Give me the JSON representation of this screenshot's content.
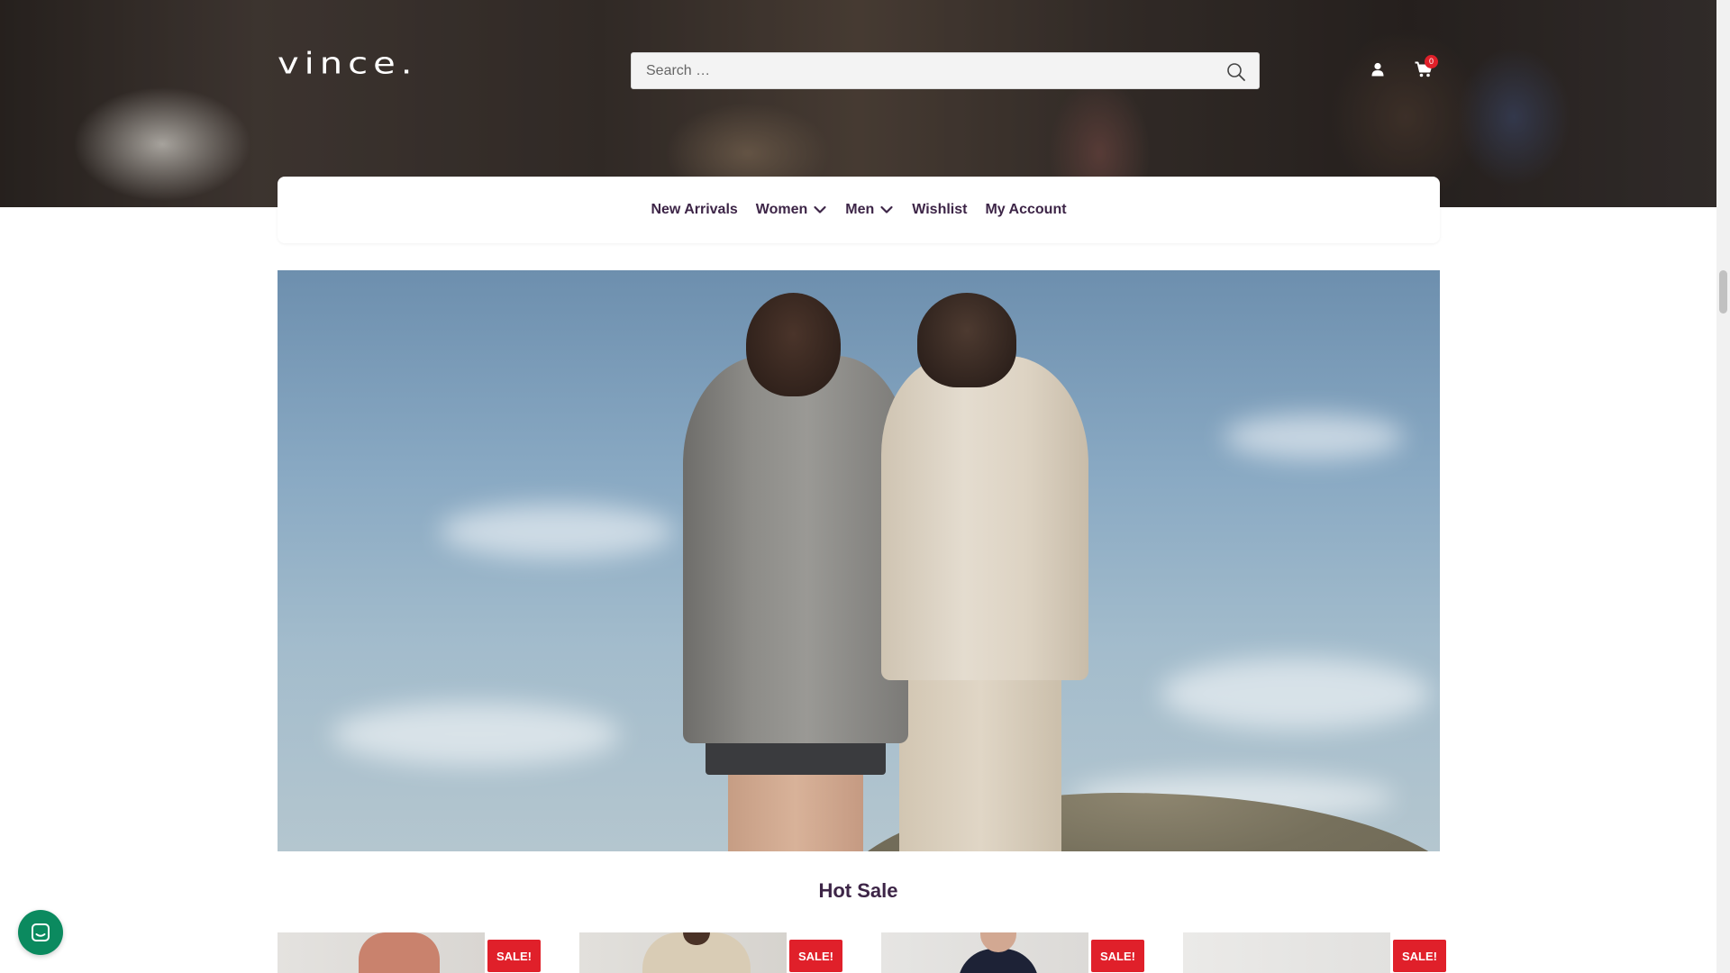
{
  "brand": {
    "logo_text": "vince."
  },
  "search": {
    "placeholder": "Search …"
  },
  "header": {
    "cart_count": "0"
  },
  "nav": {
    "items": [
      {
        "label": "New Arrivals",
        "has_dropdown": false
      },
      {
        "label": "Women",
        "has_dropdown": true
      },
      {
        "label": "Men",
        "has_dropdown": true
      },
      {
        "label": "Wishlist",
        "has_dropdown": false
      },
      {
        "label": "My Account",
        "has_dropdown": false
      }
    ]
  },
  "section": {
    "title": "Hot Sale"
  },
  "products": [
    {
      "badge": "SALE!"
    },
    {
      "badge": "SALE!"
    },
    {
      "badge": "SALE!"
    },
    {
      "badge": "SALE!"
    }
  ],
  "colors": {
    "nav_text": "#3d2547",
    "sale_badge": "#e0202a",
    "cart_badge": "#e0202a",
    "chat_button": "#0b8a5f"
  },
  "icons": {
    "search": "search-icon",
    "user": "user-icon",
    "cart": "cart-icon",
    "dropdown": "chevron-down-icon",
    "chat": "chat-icon"
  }
}
